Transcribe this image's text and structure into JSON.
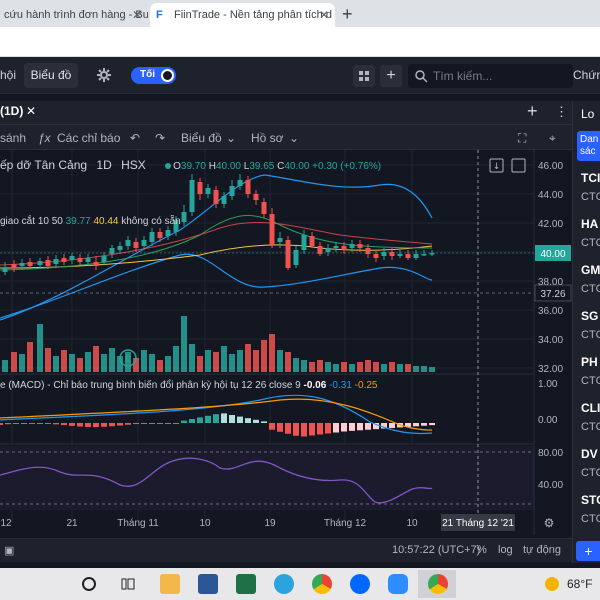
{
  "browser": {
    "tabs": [
      {
        "label": "cứu hành trình đơn hàng - Bư"
      },
      {
        "label": "FiinTrade - Nền tảng phân tích d"
      }
    ]
  },
  "topbar": {
    "left_label": "hội",
    "chart_label": "Biểu đồ",
    "toggle_label": "Tối",
    "search_placeholder": "Tìm kiếm...",
    "right_label": "Chứn"
  },
  "chart_tab": {
    "label": "(1D)"
  },
  "toolbar": {
    "compare": "sánh",
    "indicators": "Các chỉ báo",
    "chart_type": "Biểu đồ",
    "profile": "Hồ sơ"
  },
  "legend": {
    "name": "ếp dỡ Tân Cảng",
    "interval": "1D",
    "exchange": "HSX",
    "open_label": "O",
    "open": "39.70",
    "high_label": "H",
    "high": "40.00",
    "low_label": "L",
    "low": "39.65",
    "close_label": "C",
    "close": "40.00",
    "change": "+0.30 (+0.76%)",
    "line2_label": "giao cắt",
    "line2_a": "10 50",
    "line2_b": "39.77",
    "line2_c": "40.44",
    "line2_d": "không có sẵn"
  },
  "macd_legend": {
    "label": "e (MACD) - Chỉ báo trung bình biến đổi phân kỳ hội tụ 12 26 close 9",
    "v1": "-0.06",
    "v2": "-0.31",
    "v3": "-0.25"
  },
  "price_axis": [
    "46.00",
    "44.00",
    "42.00",
    "40.00",
    "38.00",
    "36.00",
    "34.00",
    "32.00"
  ],
  "price_tags": {
    "current": "40.00",
    "line": "37.26"
  },
  "macd_axis": [
    "1.00",
    "0.00"
  ],
  "rsi_axis": [
    "80.00",
    "40.00"
  ],
  "time_axis": [
    "12",
    "21",
    "Tháng 11",
    "10",
    "19",
    "Tháng 12",
    "10"
  ],
  "time_highlight": "21 Tháng 12 '21",
  "bottom_bar": {
    "clock": "10:57:22 (UTC+7)",
    "percent": "%",
    "log": "log",
    "auto": "tự động"
  },
  "right_panel": {
    "title": "Lo",
    "tab": "Dan",
    "tab2": "sác",
    "items": [
      {
        "sym": "TCI",
        "sub": "CTC"
      },
      {
        "sym": "HA",
        "sub": "CTC"
      },
      {
        "sym": "GM",
        "sub": "CTC"
      },
      {
        "sym": "SG",
        "sub": "CTC"
      },
      {
        "sym": "PH",
        "sub": "CTC"
      },
      {
        "sym": "CLI",
        "sub": "CTC"
      },
      {
        "sym": "DV",
        "sub": "CTC"
      },
      {
        "sym": "STO",
        "sub": "CTC"
      }
    ]
  },
  "taskbar": {
    "temperature": "68°F"
  },
  "colors": {
    "up": "#26a69a",
    "down": "#ef5350",
    "accent": "#2962ff",
    "bg": "#131722"
  }
}
